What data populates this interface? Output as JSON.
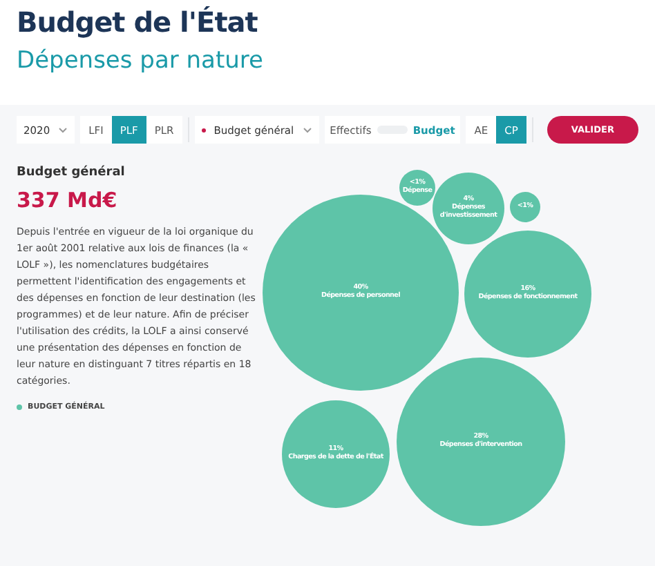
{
  "header": {
    "title": "Budget de l'État",
    "subtitle": "Dépenses par nature"
  },
  "toolbar": {
    "year": "2020",
    "versions": [
      {
        "label": "LFI",
        "selected": false
      },
      {
        "label": "PLF",
        "selected": true
      },
      {
        "label": "PLR",
        "selected": false
      }
    ],
    "scope": "Budget général",
    "mode": [
      {
        "label": "Effectifs",
        "selected": false
      },
      {
        "label": "Budget",
        "selected": true
      }
    ],
    "credits": [
      {
        "label": "AE",
        "selected": false
      },
      {
        "label": "CP",
        "selected": true
      }
    ],
    "button": "VALIDER"
  },
  "panel": {
    "heading": "Budget général",
    "amount": "337 Md€",
    "description": "Depuis l'entrée en vigueur de la loi organique du 1er août 2001 relative aux lois de finances (la « LOLF »), les nomenclatures budgétaires permettent l'identification des engagements et des dépenses en fonction de leur destination (les programmes) et de leur nature. Afin de préciser l'utilisation des crédits, la LOLF a ainsi conservé une présentation des dépenses en fonction de leur nature en distinguant 7 titres répartis en 18 catégories.",
    "legend": "BUDGET GÉNÉRAL"
  },
  "bubbles": [
    {
      "share": "<1%",
      "label": "Dépense"
    },
    {
      "share": "4%",
      "label": "Dépenses d'investissement"
    },
    {
      "share": "<1%"
    },
    {
      "share": "40%",
      "label": "Dépenses de personnel"
    },
    {
      "share": "16%",
      "label": "Dépenses de fonctionnement"
    },
    {
      "share": "11%",
      "label": "Charges de la dette de l'État"
    },
    {
      "share": "28%",
      "label": "Dépenses d'intervention"
    }
  ]
}
